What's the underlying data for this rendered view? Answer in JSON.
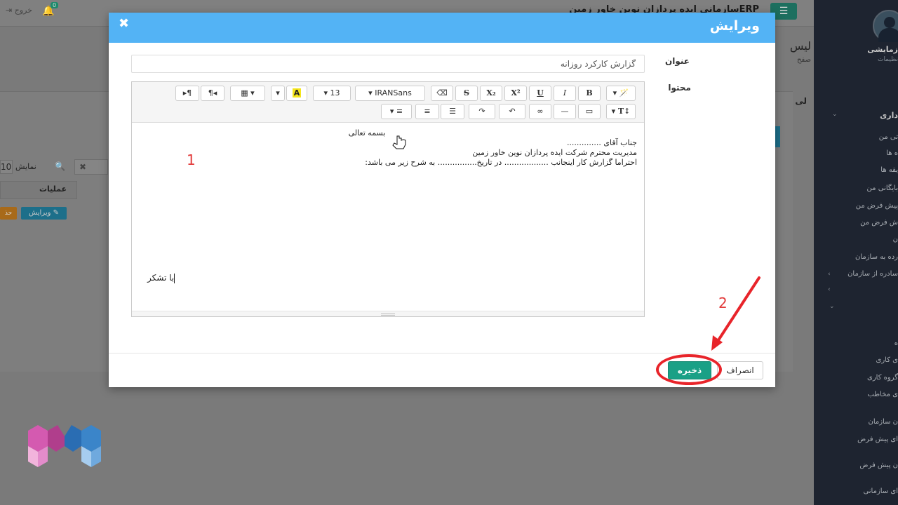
{
  "background": {
    "app_title": "ERPسازمانی ایده پردازان نوین خاور زمین",
    "menu_icon": "hamburger-icon",
    "notification_count": "0",
    "logout_label": "خروج",
    "page_title": "لیس",
    "page_subtitle": "صفح",
    "panel_header": "لی",
    "search_placeholder": "",
    "show_label": "نمایش",
    "show_count": "10",
    "ops_header": "عملیات",
    "edit_button": "ویرایش",
    "delete_button": "حذ"
  },
  "sidebar": {
    "user_name": "زمایشی",
    "user_sub": "نظیمات",
    "items": [
      {
        "label": "داری",
        "head": true
      },
      {
        "label": "تی من"
      },
      {
        "label": "ه ها"
      },
      {
        "label": "یقه ها"
      },
      {
        "label": "بایگانی من"
      },
      {
        "label": "پیش فرض من"
      },
      {
        "label": "ش فرض من"
      },
      {
        "label": "ن"
      },
      {
        "label": "رده به سازمان"
      },
      {
        "label": "سادره از سازمان"
      },
      {
        "label": "ه"
      },
      {
        "label": "ی کاری"
      },
      {
        "label": "گروه کاری"
      },
      {
        "label": "ی مخاطب"
      },
      {
        "label": "ن سازمان"
      },
      {
        "label": "ای پیش فرض"
      },
      {
        "label": "ن پیش فرض"
      },
      {
        "label": "ای سازمانی"
      }
    ]
  },
  "modal": {
    "title": "ویرایش",
    "close_icon": "close-icon",
    "fields": {
      "title_label": "عنوان",
      "title_value": "گزارش کارکرد روزانه",
      "content_label": "محتوا"
    },
    "toolbar": {
      "font_name": "IRANSans",
      "font_size": "13",
      "buttons_row1": [
        "magic-wand",
        "bold",
        "italic",
        "underline",
        "superscript",
        "subscript",
        "strikethrough",
        "eraser",
        "font-family",
        "font-size",
        "highlight-color",
        "color-dropdown",
        "table",
        "rtl",
        "ltr"
      ],
      "buttons_row2": [
        "text-height",
        "picture",
        "horizontal-rule",
        "link",
        "undo",
        "redo",
        "unordered-list",
        "ordered-list",
        "align"
      ],
      "labels": {
        "bold": "B",
        "italic": "I",
        "underline": "U",
        "superscript": "X²",
        "subscript": "X₂",
        "strikethrough": "S",
        "highlight": "A",
        "text_height": "T↕"
      }
    },
    "editor_content": {
      "line1": "بسمه تعالی",
      "line2": "جناب آقای ..............",
      "line3": "مدیریت محترم شرکت ایده پردازان نوین خاور زمین",
      "line4": "احتراما گزارش کار اینجانب .................. در تاریخ................ به شرح زیر می باشد:",
      "closing": "با تشکر"
    },
    "buttons": {
      "cancel": "انصراف",
      "save": "ذخیره"
    }
  },
  "annotations": {
    "marker1": "1",
    "marker2": "2",
    "accent_color": "#e8242a"
  }
}
